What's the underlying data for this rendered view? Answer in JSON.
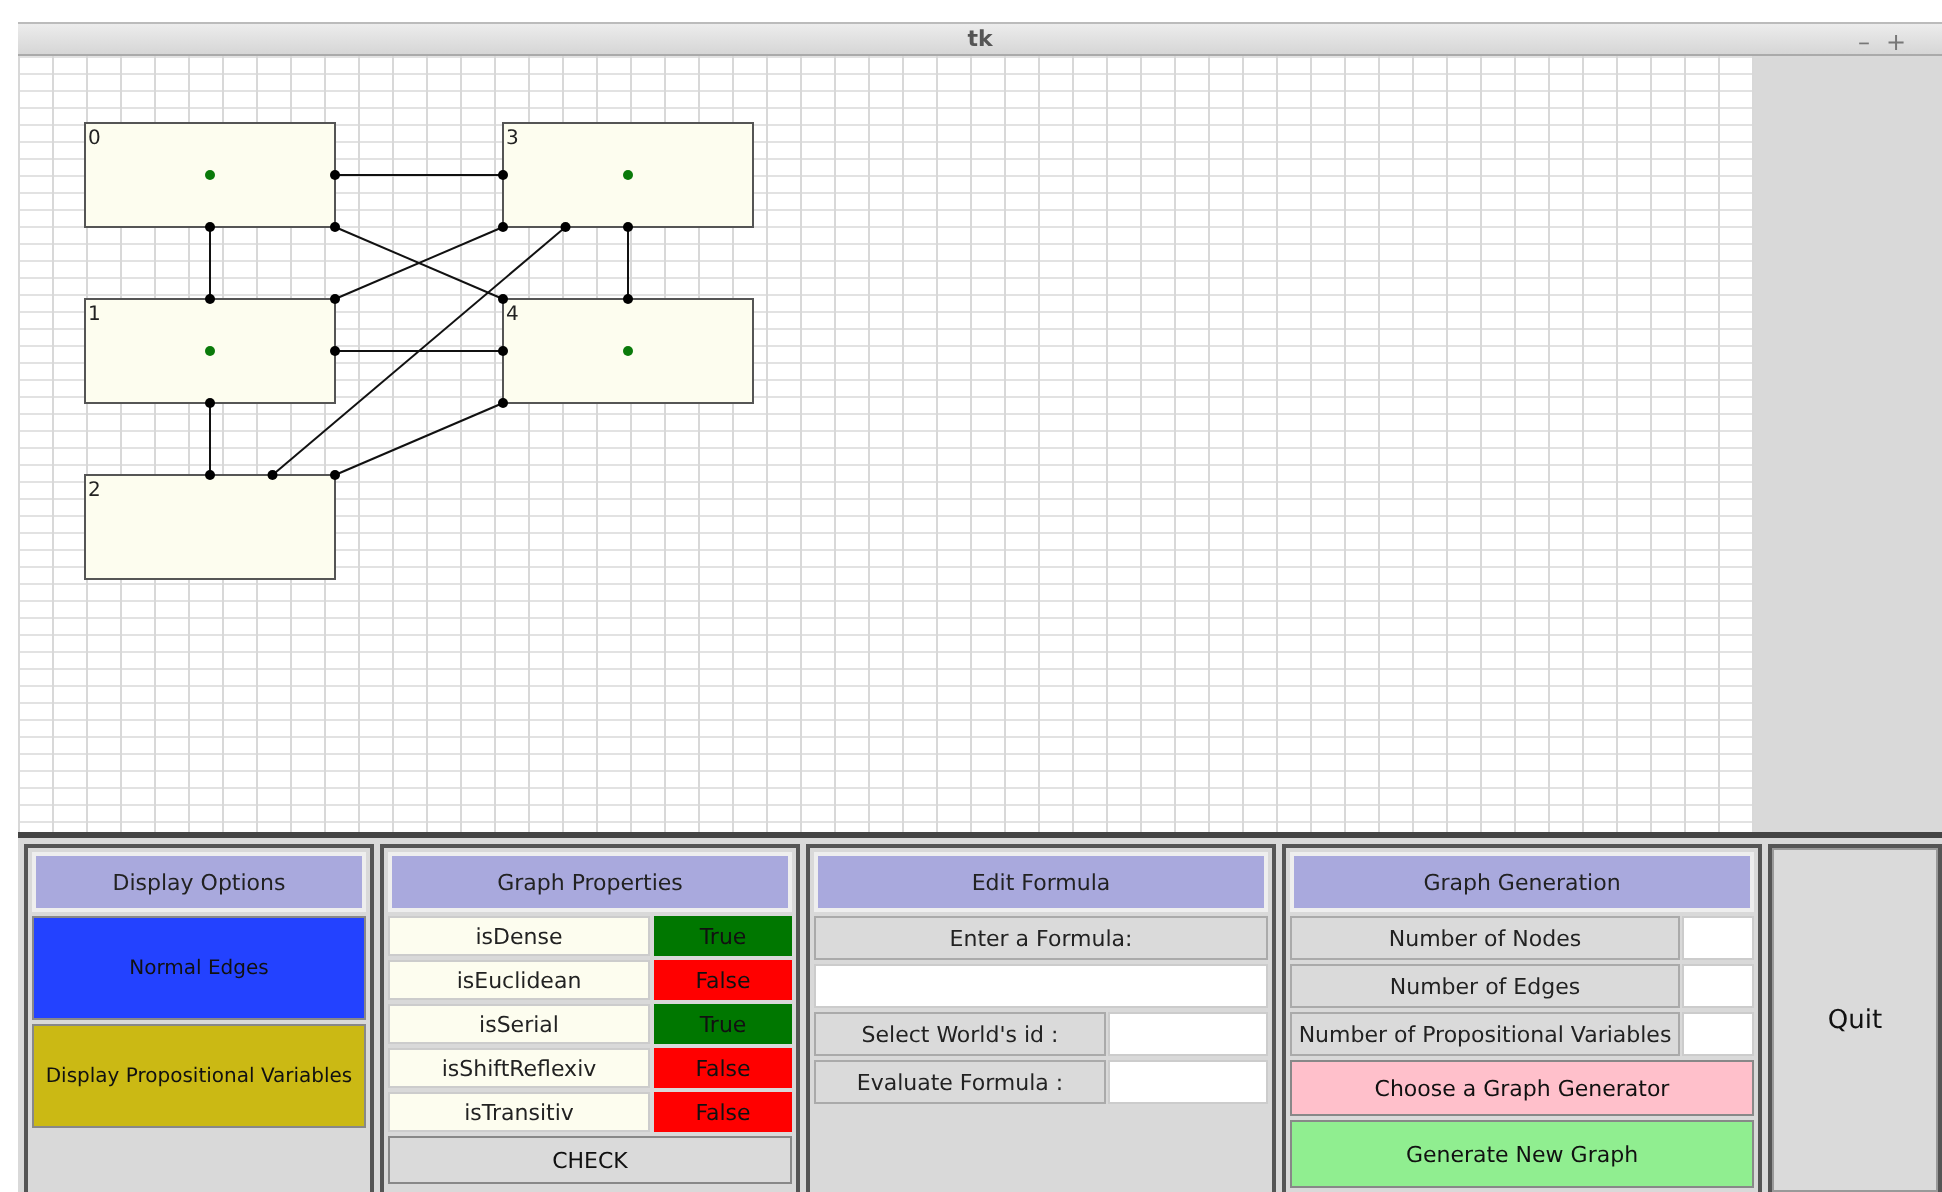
{
  "window": {
    "title": "tk",
    "controls": [
      "–",
      "+"
    ]
  },
  "graph": {
    "nodes": [
      {
        "label": "0",
        "has_variables": true
      },
      {
        "label": "1",
        "has_variables": true
      },
      {
        "label": "2",
        "has_variables": false
      },
      {
        "label": "3",
        "has_variables": true
      },
      {
        "label": "4",
        "has_variables": true
      }
    ]
  },
  "display_options": {
    "title": "Display Options",
    "buttons": [
      {
        "label": "Normal Edges",
        "color": "#2342ff"
      },
      {
        "label": "Display Propositional Variables",
        "color": "#cbb914"
      }
    ]
  },
  "graph_properties": {
    "title": "Graph Properties",
    "rows": [
      {
        "name": "isDense",
        "value": "True",
        "holds": true
      },
      {
        "name": "isEuclidean",
        "value": "False",
        "holds": false
      },
      {
        "name": "isSerial",
        "value": "True",
        "holds": true
      },
      {
        "name": "isShiftReflexiv",
        "value": "False",
        "holds": false
      },
      {
        "name": "isTransitiv",
        "value": "False",
        "holds": false
      }
    ],
    "check_button": "CHECK"
  },
  "edit_formula": {
    "title": "Edit Formula",
    "prompt": "Enter a Formula:",
    "fields": [
      {
        "label": "Select World's id :"
      },
      {
        "label": "Evaluate Formula :"
      }
    ]
  },
  "graph_generation": {
    "title": "Graph Generation",
    "fields": [
      {
        "label": "Number of Nodes"
      },
      {
        "label": "Number of Edges"
      },
      {
        "label": "Number of Propositional Variables"
      }
    ],
    "generator_button": "Choose a Graph Generator",
    "generate_button": "Generate New Graph"
  },
  "quit_button": "Quit"
}
